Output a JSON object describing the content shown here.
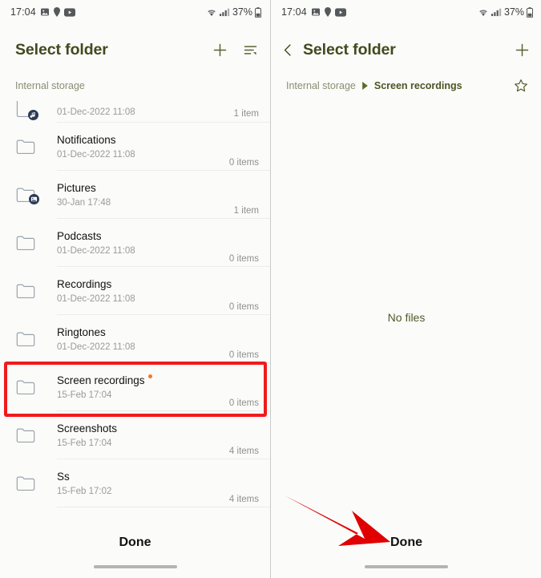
{
  "status_bar": {
    "time": "17:04",
    "battery_text": "37%",
    "icons": [
      "gallery-icon",
      "location-pin-icon",
      "youtube-icon",
      "wifi-icon",
      "signal-icon",
      "battery-icon"
    ]
  },
  "left_panel": {
    "title": "Select folder",
    "actions": [
      "add-folder-icon",
      "sort-icon"
    ],
    "storage_label": "Internal storage",
    "done_label": "Done",
    "rows": [
      {
        "name": "",
        "date": "01-Dec-2022 11:08",
        "count": "1 item",
        "icon": "folder-music-icon",
        "clipped": true,
        "badge": false
      },
      {
        "name": "Notifications",
        "date": "01-Dec-2022 11:08",
        "count": "0 items",
        "icon": "folder-icon",
        "clipped": false,
        "badge": false
      },
      {
        "name": "Pictures",
        "date": "30-Jan 17:48",
        "count": "1 item",
        "icon": "folder-image-icon",
        "clipped": false,
        "badge": false
      },
      {
        "name": "Podcasts",
        "date": "01-Dec-2022 11:08",
        "count": "0 items",
        "icon": "folder-icon",
        "clipped": false,
        "badge": false
      },
      {
        "name": "Recordings",
        "date": "01-Dec-2022 11:08",
        "count": "0 items",
        "icon": "folder-icon",
        "clipped": false,
        "badge": false
      },
      {
        "name": "Ringtones",
        "date": "01-Dec-2022 11:08",
        "count": "0 items",
        "icon": "folder-icon",
        "clipped": false,
        "badge": false
      },
      {
        "name": "Screen recordings",
        "date": "15-Feb 17:04",
        "count": "0 items",
        "icon": "folder-icon",
        "clipped": false,
        "badge": true
      },
      {
        "name": "Screenshots",
        "date": "15-Feb 17:04",
        "count": "4 items",
        "icon": "folder-icon",
        "clipped": false,
        "badge": false
      },
      {
        "name": "Ss",
        "date": "15-Feb 17:02",
        "count": "4 items",
        "icon": "folder-icon",
        "clipped": false,
        "badge": false
      }
    ],
    "highlighted_row": "Screen recordings"
  },
  "right_panel": {
    "title": "Select folder",
    "back_icon": "chevron-left-icon",
    "actions": [
      "add-folder-icon"
    ],
    "breadcrumb": {
      "parent": "Internal storage",
      "separator": "triangle-right-icon",
      "current": "Screen recordings",
      "favorite_icon": "star-outline-icon"
    },
    "empty_state": "No files",
    "done_label": "Done"
  },
  "annotations": {
    "highlight_color": "#ef1b1b",
    "arrow_color": "#e00000",
    "arrow_target": "Done"
  },
  "colors": {
    "accent_olive": "#424a20",
    "accent_olive_muted": "#8a8d72",
    "badge_orange": "#f4762a",
    "background": "#fbfbf9",
    "folder_outline": "#9aa3ad",
    "folder_badge": "#2b3a55",
    "divider": "#ececec"
  }
}
